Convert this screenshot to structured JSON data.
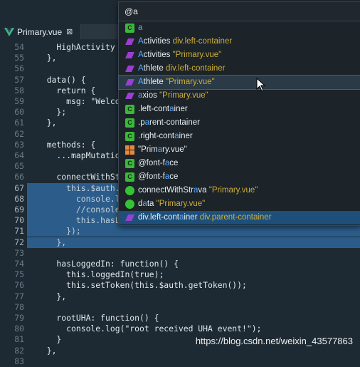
{
  "tab": {
    "label": "Primary.vue",
    "close": "⊠"
  },
  "search": {
    "value": "@a",
    "placeholder": ""
  },
  "code": [
    {
      "n": "54",
      "t": "    HighActivity",
      "sel": false,
      "cls": "t-str"
    },
    {
      "n": "55",
      "t": "  },",
      "sel": false
    },
    {
      "n": "56",
      "t": "",
      "sel": false
    },
    {
      "n": "57",
      "t": "  data() {",
      "sel": false
    },
    {
      "n": "58",
      "t": "    return {",
      "sel": false
    },
    {
      "n": "59",
      "t": "      msg: \"Welcome",
      "sel": false
    },
    {
      "n": "60",
      "t": "    };",
      "sel": false
    },
    {
      "n": "61",
      "t": "  },",
      "sel": false
    },
    {
      "n": "62",
      "t": "",
      "sel": false
    },
    {
      "n": "63",
      "t": "  methods: {",
      "sel": false
    },
    {
      "n": "64",
      "t": "    ...mapMutations",
      "sel": false
    },
    {
      "n": "65",
      "t": "",
      "sel": false
    },
    {
      "n": "66",
      "t": "    connectWithStra",
      "sel": false
    },
    {
      "n": "67",
      "t": "      this.$auth.au",
      "sel": true
    },
    {
      "n": "68",
      "t": "        console.log",
      "sel": true
    },
    {
      "n": "69",
      "t": "        //console.l",
      "sel": true
    },
    {
      "n": "70",
      "t": "        this.hasLog",
      "sel": true
    },
    {
      "n": "71",
      "t": "      });",
      "sel": true
    },
    {
      "n": "72",
      "t": "    },",
      "sel": true
    },
    {
      "n": "73",
      "t": "",
      "sel": false
    },
    {
      "n": "74",
      "t": "    hasLoggedIn: function() {",
      "sel": false
    },
    {
      "n": "75",
      "t": "      this.loggedIn(true);",
      "sel": false
    },
    {
      "n": "76",
      "t": "      this.setToken(this.$auth.getToken());",
      "sel": false
    },
    {
      "n": "77",
      "t": "    },",
      "sel": false
    },
    {
      "n": "78",
      "t": "",
      "sel": false
    },
    {
      "n": "79",
      "t": "    rootUHA: function() {",
      "sel": false
    },
    {
      "n": "80",
      "t": "      console.log(\"root received UHA event!\");",
      "sel": false
    },
    {
      "n": "81",
      "t": "    }",
      "sel": false
    },
    {
      "n": "82",
      "t": "  },",
      "sel": false
    },
    {
      "n": "83",
      "t": "",
      "sel": false
    }
  ],
  "items": [
    {
      "icon": "css-class-icon",
      "pre": "",
      "m": "a",
      "post": "",
      "desc": "",
      "state": ""
    },
    {
      "icon": "vue-data-icon",
      "pre": "",
      "m": "A",
      "post": "ctivities ",
      "desc": "div.left-container",
      "state": ""
    },
    {
      "icon": "vue-data-icon",
      "pre": "",
      "m": "A",
      "post": "ctivities ",
      "desc": "\"Primary.vue\"",
      "state": ""
    },
    {
      "icon": "vue-data-icon",
      "pre": "",
      "m": "A",
      "post": "thlete ",
      "desc": "div.left-container",
      "state": ""
    },
    {
      "icon": "vue-data-icon",
      "pre": "",
      "m": "A",
      "post": "thlete ",
      "desc": "\"Primary.vue\"",
      "state": "hover"
    },
    {
      "icon": "vue-data-icon",
      "pre": "",
      "m": "a",
      "post": "xios ",
      "desc": "\"Primary.vue\"",
      "state": ""
    },
    {
      "icon": "css-class-icon",
      "pre": ".left-cont",
      "m": "a",
      "post": "iner",
      "desc": "",
      "state": ""
    },
    {
      "icon": "css-class-icon",
      "pre": ".p",
      "m": "a",
      "post": "rent-container",
      "desc": "",
      "state": ""
    },
    {
      "icon": "css-class-icon",
      "pre": ".right-cont",
      "m": "a",
      "post": "iner",
      "desc": "",
      "state": ""
    },
    {
      "icon": "file-grid-icon",
      "pre": "\"Prim",
      "m": "a",
      "post": "ry.vue\"",
      "desc": "",
      "state": ""
    },
    {
      "icon": "css-class-icon",
      "pre": "@font-f",
      "m": "a",
      "post": "ce",
      "desc": "",
      "state": ""
    },
    {
      "icon": "css-class-icon",
      "pre": "@font-f",
      "m": "a",
      "post": "ce",
      "desc": "",
      "state": ""
    },
    {
      "icon": "method-icon",
      "pre": "connectWithStr",
      "m": "a",
      "post": "va ",
      "desc": "\"Primary.vue\"",
      "state": ""
    },
    {
      "icon": "method-icon",
      "pre": "d",
      "m": "a",
      "post": "ta ",
      "desc": "\"Primary.vue\"",
      "state": ""
    },
    {
      "icon": "element-icon",
      "pre": "div.left-cont",
      "m": "a",
      "post": "iner ",
      "desc": "div.parent-container",
      "state": "selected"
    }
  ],
  "watermark": "https://blog.csdn.net/weixin_43577863"
}
